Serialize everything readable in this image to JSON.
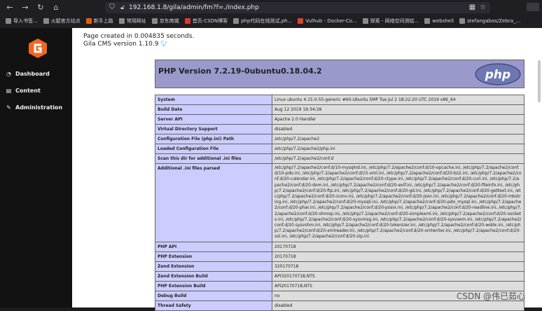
{
  "browser": {
    "url": "192.168.1.8/gila/admin/fm?f=./index.php",
    "bookmarks": [
      {
        "label": "导入书签...",
        "color": "#8a8a8a"
      },
      {
        "label": "火狐官方站点",
        "color": "#8a8a8a"
      },
      {
        "label": "新手上路",
        "color": "#e66000"
      },
      {
        "label": "常用网址",
        "color": "#8a8a8a"
      },
      {
        "label": "京东商城",
        "color": "#8a8a8a"
      },
      {
        "label": "首页-CSDN博客",
        "color": "#e0362c"
      },
      {
        "label": "php代码在线测试,ph...",
        "color": "#8a8a8a"
      },
      {
        "label": "Vulhub - Docker-Co...",
        "color": "#d9442b"
      },
      {
        "label": "探索 - 网络空间测绘...",
        "color": "#8a8a8a"
      },
      {
        "label": "webshell",
        "color": "#8a8a8a"
      },
      {
        "label": "stefangabos/Zebra_...",
        "color": "#8a8a8a"
      }
    ]
  },
  "sidebar": {
    "accent": "#f26522",
    "items": [
      {
        "label": "Dashboard",
        "icon": "tachometer-icon"
      },
      {
        "label": "Content",
        "icon": "window-icon"
      },
      {
        "label": "Administration",
        "icon": "wrench-icon"
      }
    ]
  },
  "content": {
    "page_created": "Page created in 0.004835 seconds.",
    "gila_version": "Gila CMS version 1.10.9"
  },
  "phpinfo": {
    "title": "PHP Version 7.2.19-0ubuntu0.18.04.2",
    "logo_text": "php",
    "rows": [
      {
        "key": "System",
        "value": "Linux ubuntu 4.15.0-55-generic #60-Ubuntu SMP Tue Jul 2 18:22:20 UTC 2019 x86_64"
      },
      {
        "key": "Build Date",
        "value": "Aug 12 2019 19:34:28"
      },
      {
        "key": "Server API",
        "value": "Apache 2.0 Handler"
      },
      {
        "key": "Virtual Directory Support",
        "value": "disabled"
      },
      {
        "key": "Configuration File (php.ini) Path",
        "value": "/etc/php/7.2/apache2"
      },
      {
        "key": "Loaded Configuration File",
        "value": "/etc/php/7.2/apache2/php.ini"
      },
      {
        "key": "Scan this dir for additional .ini files",
        "value": "/etc/php/7.2/apache2/conf.d"
      },
      {
        "key": "Additional .ini files parsed",
        "value": "/etc/php/7.2/apache2/conf.d/10-mysqlnd.ini, /etc/php/7.2/apache2/conf.d/10-opcache.ini, /etc/php/7.2/apache2/conf.d/10-pdo.ini, /etc/php/7.2/apache2/conf.d/15-xml.ini, /etc/php/7.2/apache2/conf.d/20-bz2.ini, /etc/php/7.2/apache2/conf.d/20-calendar.ini, /etc/php/7.2/apache2/conf.d/20-ctype.ini, /etc/php/7.2/apache2/conf.d/20-curl.ini, /etc/php/7.2/apache2/conf.d/20-dom.ini, /etc/php/7.2/apache2/conf.d/20-exif.ini, /etc/php/7.2/apache2/conf.d/20-fileinfo.ini, /etc/php/7.2/apache2/conf.d/20-ftp.ini, /etc/php/7.2/apache2/conf.d/20-gd.ini, /etc/php/7.2/apache2/conf.d/20-gettext.ini, /etc/php/7.2/apache2/conf.d/20-iconv.ini, /etc/php/7.2/apache2/conf.d/20-json.ini, /etc/php/7.2/apache2/conf.d/20-mbstring.ini, /etc/php/7.2/apache2/conf.d/20-mysqli.ini, /etc/php/7.2/apache2/conf.d/20-pdo_mysql.ini, /etc/php/7.2/apache2/conf.d/20-phar.ini, /etc/php/7.2/apache2/conf.d/20-posix.ini, /etc/php/7.2/apache2/conf.d/20-readline.ini, /etc/php/7.2/apache2/conf.d/20-shmop.ini, /etc/php/7.2/apache2/conf.d/20-simplexml.ini, /etc/php/7.2/apache2/conf.d/20-sockets.ini, /etc/php/7.2/apache2/conf.d/20-sysvmsg.ini, /etc/php/7.2/apache2/conf.d/20-sysvsem.ini, /etc/php/7.2/apache2/conf.d/20-sysvshm.ini, /etc/php/7.2/apache2/conf.d/20-tokenizer.ini, /etc/php/7.2/apache2/conf.d/20-wddx.ini, /etc/php/7.2/apache2/conf.d/20-xmlreader.ini, /etc/php/7.2/apache2/conf.d/20-xmlwriter.ini, /etc/php/7.2/apache2/conf.d/20-xsl.ini, /etc/php/7.2/apache2/conf.d/20-zip.ini"
      },
      {
        "key": "PHP API",
        "value": "20170718"
      },
      {
        "key": "PHP Extension",
        "value": "20170718"
      },
      {
        "key": "Zend Extension",
        "value": "320170718"
      },
      {
        "key": "Zend Extension Build",
        "value": "API320170718,NTS"
      },
      {
        "key": "PHP Extension Build",
        "value": "API20170718,NTS"
      },
      {
        "key": "Debug Build",
        "value": "no"
      },
      {
        "key": "Thread Safety",
        "value": "disabled"
      }
    ]
  },
  "watermark": "CSDN @伟已茹心"
}
